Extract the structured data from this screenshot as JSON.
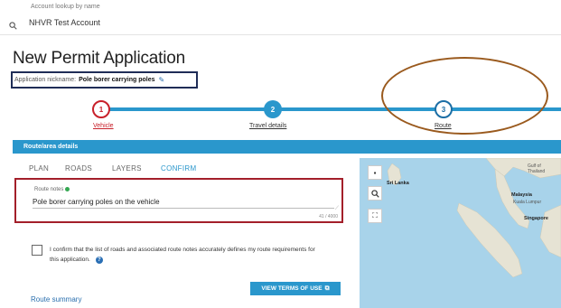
{
  "account": {
    "label": "Account lookup by name",
    "name": "NHVR Test Account"
  },
  "page": {
    "title": "New Permit Application"
  },
  "nickname": {
    "label": "Application nickname:",
    "value": "Pole borer carrying poles"
  },
  "stepper": {
    "steps": [
      {
        "number": "1",
        "label": "Vehicle",
        "state": "error"
      },
      {
        "number": "2",
        "label": "Travel details",
        "state": "complete"
      },
      {
        "number": "3",
        "label": "Route",
        "state": "current"
      }
    ]
  },
  "section": {
    "title": "Route/area details"
  },
  "tabs": [
    {
      "label": "PLAN"
    },
    {
      "label": "ROADS"
    },
    {
      "label": "LAYERS"
    },
    {
      "label": "CONFIRM",
      "active": true
    }
  ],
  "route_notes": {
    "label": "Route notes",
    "value": "Pole borer carrying poles on the vehicle",
    "counter": "41 / 4000"
  },
  "confirm": {
    "text": "I confirm that the list of roads and associated route notes accurately defines my route requirements for this application."
  },
  "terms_button": {
    "label": "VIEW TERMS OF USE"
  },
  "route_summary": {
    "label": "Route summary"
  },
  "map": {
    "labels": {
      "sri_lanka": "Sri Lanka",
      "malaysia": "Malaysia",
      "singapore": "Singapore",
      "gulf": "Gulf of Thailand",
      "kuala_lumpur": "Kuala Lumpur"
    },
    "icons": [
      "camera-icon",
      "search-icon",
      "fullscreen-icon"
    ]
  },
  "colors": {
    "accent": "#2a97cc",
    "error": "#c8202a",
    "nickname_border": "#1f2d57",
    "annotation": "#9a5a1e",
    "notes_border": "#a31f2a"
  }
}
